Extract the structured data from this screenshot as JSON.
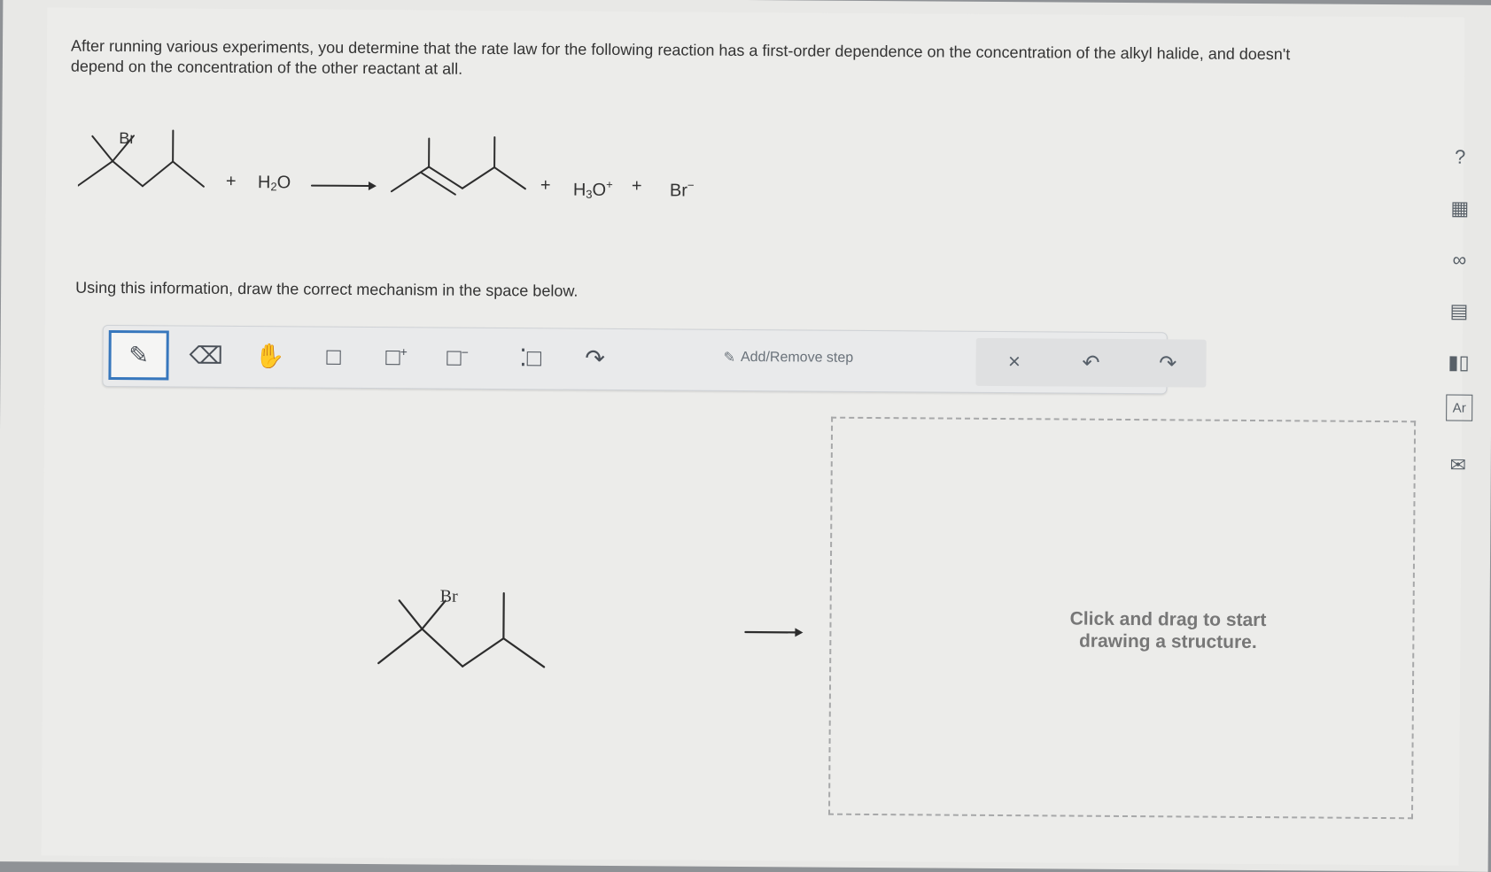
{
  "question": {
    "text": "After running various experiments, you determine that the rate law for the following reaction has a first-order dependence on the concentration of the alkyl halide, and doesn't depend on the concentration of the other reactant at all."
  },
  "reaction": {
    "reactant_label": "Br",
    "plus_1": "+",
    "water": "H",
    "water_sub": "2",
    "water_o": "O",
    "plus_2": "+",
    "hydronium_h": "H",
    "hydronium_sub": "3",
    "hydronium_o": "O",
    "hydronium_charge": "+",
    "plus_3": "+",
    "bromide": "Br",
    "bromide_charge": "−"
  },
  "instruction": "Using this information, draw the correct mechanism in the space below.",
  "toolbar": {
    "tools": [
      {
        "name": "pencil-icon"
      },
      {
        "name": "eraser-icon"
      },
      {
        "name": "hand-icon"
      },
      {
        "name": "selection-box-icon"
      },
      {
        "name": "positive-charge-icon",
        "charge": "+"
      },
      {
        "name": "negative-charge-icon",
        "charge": "−"
      },
      {
        "name": "lone-pair-icon"
      },
      {
        "name": "curved-arrow-icon"
      }
    ],
    "add_remove_label": "Add/Remove step"
  },
  "mechanism": {
    "molecule_label": "Br"
  },
  "drawing_area": {
    "placeholder": "Click and drag to start drawing a structure."
  },
  "side_tools": {
    "help": "?",
    "periodic_table": "Ar"
  }
}
